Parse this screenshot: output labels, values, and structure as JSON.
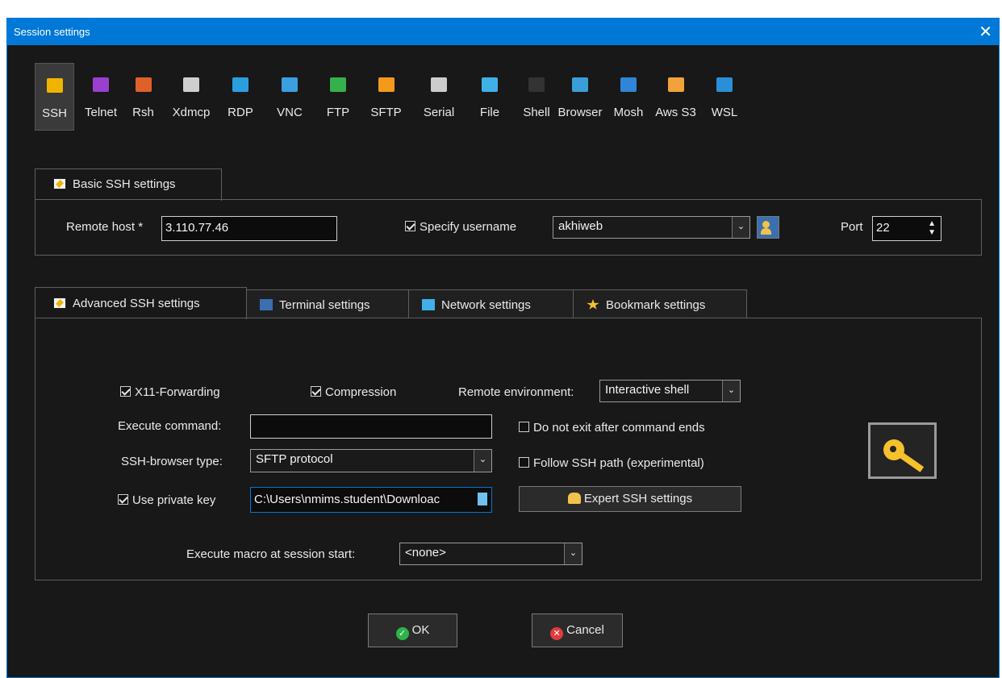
{
  "window": {
    "title": "Session settings",
    "close_glyph": "✕"
  },
  "protocols": [
    {
      "label": "SSH",
      "icon": "ssh-icon",
      "color": "#f0b400",
      "active": true
    },
    {
      "label": "Telnet",
      "icon": "telnet-icon",
      "color": "#9b3fd0"
    },
    {
      "label": "Rsh",
      "icon": "rsh-icon",
      "color": "#e0602a"
    },
    {
      "label": "Xdmcp",
      "icon": "xdmcp-icon",
      "color": "#cfcfcf"
    },
    {
      "label": "RDP",
      "icon": "rdp-icon",
      "color": "#2a9fe0"
    },
    {
      "label": "VNC",
      "icon": "vnc-icon",
      "color": "#3aa0e0"
    },
    {
      "label": "FTP",
      "icon": "ftp-icon",
      "color": "#35b04a"
    },
    {
      "label": "SFTP",
      "icon": "sftp-icon",
      "color": "#f39a1a"
    },
    {
      "label": "Serial",
      "icon": "serial-icon",
      "color": "#cccccc"
    },
    {
      "label": "File",
      "icon": "file-icon",
      "color": "#3fb0e8"
    },
    {
      "label": "Shell",
      "icon": "shell-icon",
      "color": "#333333"
    },
    {
      "label": "Browser",
      "icon": "browser-icon",
      "color": "#3a9fd8"
    },
    {
      "label": "Mosh",
      "icon": "mosh-icon",
      "color": "#2f86d6"
    },
    {
      "label": "Aws S3",
      "icon": "aws-s3-icon",
      "color": "#f2a23a"
    },
    {
      "label": "WSL",
      "icon": "wsl-icon",
      "color": "#2a8fd8"
    }
  ],
  "basic": {
    "tab_label": "Basic SSH settings",
    "remote_host_label": "Remote host *",
    "remote_host_value": "3.110.77.46",
    "specify_username_label": "Specify username",
    "specify_username_checked": true,
    "username_value": "akhiweb",
    "port_label": "Port",
    "port_value": "22"
  },
  "tabs": [
    {
      "label": "Advanced SSH settings",
      "icon": "wrench-icon",
      "active": true
    },
    {
      "label": "Terminal settings",
      "icon": "terminal-icon"
    },
    {
      "label": "Network settings",
      "icon": "network-icon"
    },
    {
      "label": "Bookmark settings",
      "icon": "star-icon"
    }
  ],
  "advanced": {
    "x11_label": "X11-Forwarding",
    "x11_checked": true,
    "compression_label": "Compression",
    "compression_checked": true,
    "remote_env_label": "Remote environment:",
    "remote_env_value": "Interactive shell",
    "execute_command_label": "Execute command:",
    "execute_command_value": "",
    "do_not_exit_label": "Do not exit after command ends",
    "do_not_exit_checked": false,
    "ssh_browser_label": "SSH-browser type:",
    "ssh_browser_value": "SFTP protocol",
    "follow_path_label": "Follow SSH path (experimental)",
    "follow_path_checked": false,
    "private_key_label": "Use private key",
    "private_key_checked": true,
    "private_key_value": "C:\\Users\\nmims.student\\Downloac",
    "expert_button_label": "Expert SSH settings",
    "macro_label": "Execute macro at session start:",
    "macro_value": "<none>"
  },
  "footer": {
    "ok_label": "OK",
    "cancel_label": "Cancel",
    "ok_color": "#2fb34a",
    "cancel_color": "#e23b3b"
  }
}
